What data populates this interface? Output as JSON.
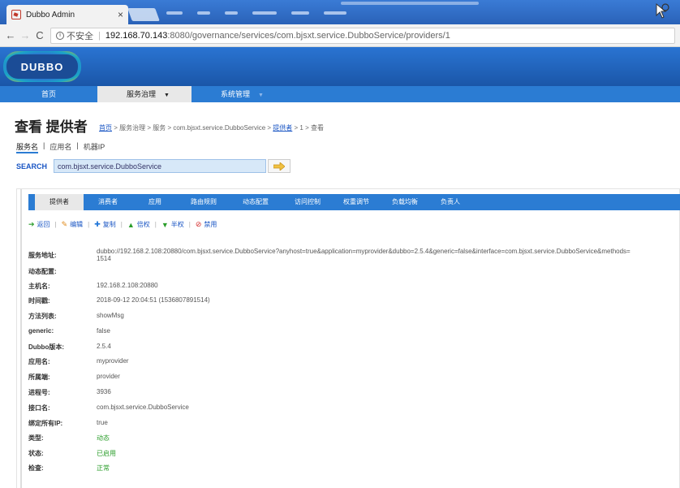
{
  "browser": {
    "tab_title": "Dubbo Admin",
    "url_info": "ⓘ",
    "url_insecure": "不安全",
    "url_host": "192.168.70.143",
    "url_rest": ":8080/governance/services/com.bjsxt.service.DubboService/providers/1"
  },
  "header": {
    "logo_text": "DUBBO"
  },
  "menu": {
    "items": [
      {
        "label": "首页"
      },
      {
        "label": "服务治理"
      },
      {
        "label": "系统管理"
      }
    ]
  },
  "page": {
    "title": "查看 提供者",
    "breadcrumb": {
      "home": "首页",
      "mid": " > 服务治理 > 服务 > com.bjsxt.service.DubboService > ",
      "providers": "提供者",
      "tail": " > 1 > 查看"
    }
  },
  "search": {
    "tabs": [
      "服务名",
      "应用名",
      "机器IP"
    ],
    "label": "SEARCH",
    "value": "com.bjsxt.service.DubboService"
  },
  "detail_tabs": [
    "提供者",
    "消费者",
    "应用",
    "路由规则",
    "动态配置",
    "访问控制",
    "权重调节",
    "负载均衡",
    "负责人"
  ],
  "actions": {
    "back": "返回",
    "edit": "编辑",
    "copy": "复制",
    "double": "倍权",
    "half": "半权",
    "disable": "禁用"
  },
  "fields": [
    {
      "key": "服务地址:",
      "value": "dubbo://192.168.2.108:20880/com.bjsxt.service.DubboService?anyhost=true&application=myprovider&dubbo=2.5.4&generic=false&interface=com.bjsxt.service.DubboService&methods=",
      "value2": "1514"
    },
    {
      "key": "动态配置:",
      "value": ""
    },
    {
      "key": "主机名:",
      "value": "192.168.2.108:20880"
    },
    {
      "key": "时间戳:",
      "value": "2018-09-12 20:04:51 (1536807891514)"
    },
    {
      "key": "方法列表:",
      "value": "showMsg"
    },
    {
      "key": "generic:",
      "value": "false"
    },
    {
      "key": "Dubbo版本:",
      "value": "2.5.4"
    },
    {
      "key": "应用名:",
      "value": "myprovider"
    },
    {
      "key": "所属端:",
      "value": "provider"
    },
    {
      "key": "进程号:",
      "value": "3936"
    },
    {
      "key": "接口名:",
      "value": "com.bjsxt.service.DubboService"
    },
    {
      "key": "绑定所有IP:",
      "value": "true"
    },
    {
      "key": "类型:",
      "value": "动态"
    },
    {
      "key": "状态:",
      "value": "已启用"
    },
    {
      "key": "检查:",
      "value": "正常"
    }
  ]
}
